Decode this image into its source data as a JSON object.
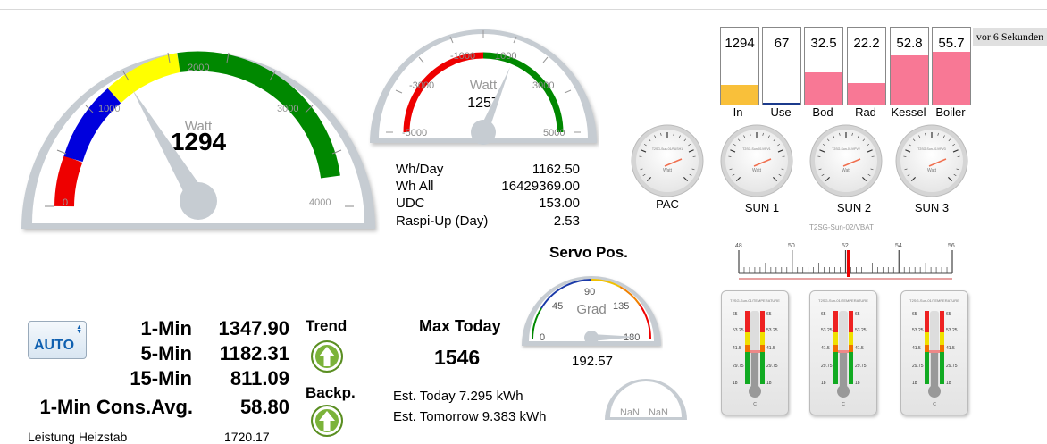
{
  "main_gauge": {
    "unit": "Watt",
    "value": "1294",
    "ticks": [
      "0",
      "1000",
      "2000",
      "3000",
      "4000"
    ]
  },
  "small_gauge": {
    "unit": "Watt",
    "value": "1257",
    "ticks": [
      "-5000",
      "-3000",
      "-1000",
      "1000",
      "3000",
      "5000"
    ]
  },
  "stats": {
    "rows": [
      {
        "label": "Wh/Day",
        "value": "1162.50"
      },
      {
        "label": "Wh All",
        "value": "16429369.00"
      },
      {
        "label": "UDC",
        "value": "153.00"
      },
      {
        "label": "Raspi-Up (Day)",
        "value": "2.53"
      }
    ]
  },
  "bars": [
    {
      "label": "In",
      "value": "1294",
      "level": 0.26,
      "color": "#f9c03a"
    },
    {
      "label": "Use",
      "value": "67",
      "level": 0.02,
      "color": "#1b3a8c"
    },
    {
      "label": "Bod",
      "value": "32.5",
      "level": 0.42,
      "color": "#f87895"
    },
    {
      "label": "Rad",
      "value": "22.2",
      "level": 0.28,
      "color": "#f87895"
    },
    {
      "label": "Kessel",
      "value": "52.8",
      "level": 0.64,
      "color": "#f87895"
    },
    {
      "label": "Boiler",
      "value": "55.7",
      "level": 0.69,
      "color": "#f87895"
    }
  ],
  "timestamp": "vor 6 Sekunden",
  "mini_gauges": [
    {
      "label": "PAC",
      "face_text": "T2SG-Sun-01/PUSH1",
      "unit": "Watt"
    },
    {
      "label": "SUN 1",
      "face_text": "T2SG-Sun-01/VPV1",
      "unit": "Watt"
    },
    {
      "label": "SUN 2",
      "face_text": "T2SG-Sun-01/VPV2",
      "unit": "Watt"
    },
    {
      "label": "SUN 3",
      "face_text": "T2SG-Sun-01/VPV3",
      "unit": "Watt"
    }
  ],
  "scale": {
    "title": "T2SG-Sun-02/VBAT",
    "ticks": [
      "48",
      "50",
      "52",
      "54",
      "56"
    ],
    "value": 52.1
  },
  "servo": {
    "title": "Servo Pos.",
    "unit": "Grad",
    "value": "192.57",
    "ticks": [
      "0",
      "45",
      "90",
      "135",
      "180"
    ]
  },
  "controls": {
    "auto_label": "AUTO",
    "trend_label": "Trend",
    "backp_label": "Backp."
  },
  "metrics": [
    {
      "label": "1-Min",
      "value": "1347.90"
    },
    {
      "label": "5-Min",
      "value": "1182.31"
    },
    {
      "label": "15-Min",
      "value": "811.09"
    },
    {
      "label": "1-Min Cons.Avg.",
      "value": "58.80"
    }
  ],
  "heizstab": {
    "label": "Leistung Heizstab",
    "value": "1720.17"
  },
  "max_today": {
    "label": "Max Today",
    "value": "1546"
  },
  "estimates": {
    "today": "Est. Today 7.295 kWh",
    "tomorrow": "Est. Tomorrow 9.383 kWh"
  },
  "nan_gauge": {
    "left": "NaN",
    "right": "NaN"
  },
  "thermometers": [
    {
      "title": "T2SG-Sun-01/TEMPERATURE",
      "ticks": [
        "65",
        "53.25",
        "41.5",
        "29.75",
        "18"
      ],
      "unit": "C"
    },
    {
      "title": "T2SG-Sun-01/TEMPERATURE",
      "ticks": [
        "65",
        "53.25",
        "41.5",
        "29.75",
        "18"
      ],
      "unit": "C"
    },
    {
      "title": "T2SG-Sun-01/TEMPERATURE",
      "ticks": [
        "65",
        "53.25",
        "41.5",
        "29.75",
        "18"
      ],
      "unit": "C"
    }
  ]
}
